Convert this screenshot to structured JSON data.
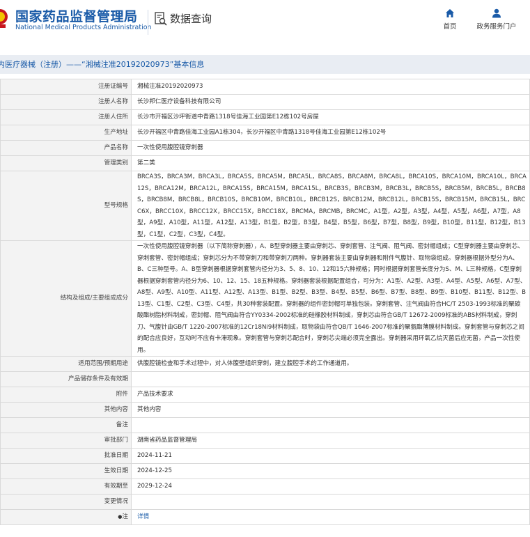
{
  "header": {
    "logo_cn": "国家药品监督管理局",
    "logo_en": "National Medical Products Administration",
    "search_label": "数据查询",
    "nav": [
      {
        "label": "首页",
        "icon": "home-icon"
      },
      {
        "label": "政务服务门户",
        "icon": "user-icon"
      }
    ]
  },
  "title": "内医疗器械（注册）——“湘械注准20192020973”基本信息",
  "fields": [
    {
      "key": "注册证编号",
      "value": "湘械注准20192020973"
    },
    {
      "key": "注册人名称",
      "value": "长沙邦仁医疗设备科技有限公司"
    },
    {
      "key": "注册人住所",
      "value": "长沙市开福区沙坪街道中青路1318号佳海工业园第E12栋102号房屋"
    },
    {
      "key": "生产地址",
      "value": "长沙开福区中青路佳海工业园A1栋304，长沙开福区中青路1318号佳海工业园第E12栋102号"
    },
    {
      "key": "产品名称",
      "value": "一次性使用腹腔镜穿刺器"
    },
    {
      "key": "管理类别",
      "value": "第二类"
    },
    {
      "key": "型号规格",
      "value": "BRCA3S，BRCA3M，BRCA3L，BRCA5S，BRCA5M，BRCA5L，BRCA8S，BRCA8M，BRCA8L，BRCA10S，BRCA10M，BRCA10L，BRCA12S，BRCA12M，BRCA12L，BRCA15S，BRCA15M，BRCA15L，BRCB3S，BRCB3M，BRCB3L，BRCB5S，BRCB5M，BRCB5L，BRCB8S，BRCB8M，BRCB8L，BRCB10S，BRCB10M，BRCB10L，BRCB12S，BRCB12M，BRCB12L，BRCB15S，BRCB15M，BRCB15L，BRCC6X，BRCC10X，BRCC12X，BRCC15X，BRCC18X，BRCMA，BRCMB，BRCMC，A1型，A2型，A3型，A4型，A5型，A6型，A7型，A8型，A9型，A10型，A11型，A12型，A13型，B1型，B2型，B3型，B4型，B5型，B6型，B7型，B8型，B9型，B10型，B11型，B12型，B13型，C1型，C2型，C3型，C4型。"
    },
    {
      "key": "结构及组成/主要组成成分",
      "value": "一次性使用腹腔镜穿刺器（以下简称穿刺器），A、B型穿刺器主要由穿刺芯、穿刺套管、注气阀、阻气阀、密封帽组成；C型穿刺器主要由穿刺芯、穿刺套管、密封帽组成；穿刺芯分为不带穿刺刀和带穿刺刀两种。穿刺器套装主要由穿刺器和附件气腹针、取物袋组成。穿刺器根据外型分为A、B、C三种型号。A、B型穿刺器根据穿刺套管内径分为3、5、8、10、12和15六种规格；同时根据穿刺套管长度分为S、M、L三种规格，C型穿刺器根据穿刺套管内径分为6、10、12、15、18五种规格。穿刺器套装根据配置组合，可分为：A1型、A2型、A3型、A4型、A5型、A6型、A7型、A8型、A9型、A10型、A11型、A12型、A13型、B1型、B2型、B3型、B4型、B5型、B6型、B7型、B8型、B9型、B10型、B11型、B12型、B13型、C1型、C2型、C3型、C4型，共30种套装配置。穿刺器的组件密封帽可单独包装。穿刺套管、注气阀由符合HC/T 2503-1993标准的聚碳酸酯树脂材料制成，密封帽、阻气阀由符合YY0334-2002标准的硅橡胶材料制成，穿刺芯由符合GB/T 12672-2009标准的ABS材料制成，穿刺刀、气腹针由GB/T 1220-2007标准的12Cr18Ni9材料制成，取物袋由符合QB/T 1646-2007标准的聚氨酯薄膜材料制成。穿刺套管与穿刺芯之间的配合应良好，互动时不应有卡滞现象。穿刺套管与穿刺芯配合时，穿刺芯尖端必须完全露出。穿刺器采用环氧乙烷灭菌后应无菌，产品一次性使用。"
    },
    {
      "key": "适用范围/预期用途",
      "value": "供腹腔镜检查和手术过程中，对人体腹壁组织穿刺，建立腹腔手术的工作通道用。"
    },
    {
      "key": "产品储存条件及有效期",
      "value": ""
    },
    {
      "key": "附件",
      "value": "产品技术要求"
    },
    {
      "key": "其他内容",
      "value": "其他内容"
    },
    {
      "key": "备注",
      "value": ""
    },
    {
      "key": "审批部门",
      "value": "湖南省药品监督管理局"
    },
    {
      "key": "批准日期",
      "value": "2024-11-21"
    },
    {
      "key": "生效日期",
      "value": "2024-12-25"
    },
    {
      "key": "有效期至",
      "value": "2029-12-24"
    },
    {
      "key": "变更情况",
      "value": ""
    }
  ],
  "note": {
    "key": "注",
    "link": "详情"
  }
}
